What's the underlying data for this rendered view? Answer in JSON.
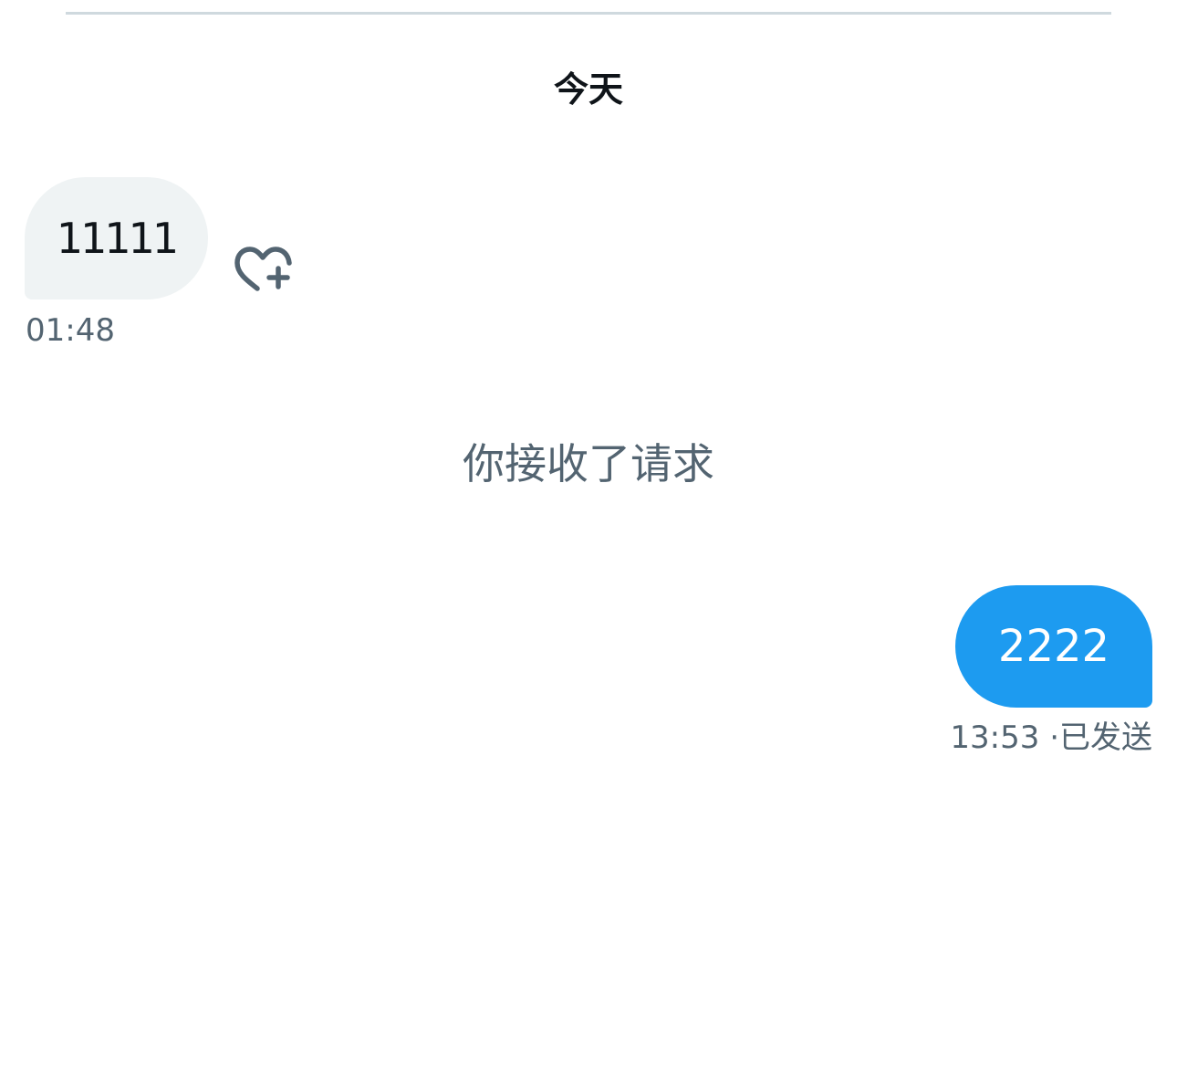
{
  "conversation": {
    "date_divider": "今天",
    "incoming": {
      "text": "11111",
      "time": "01:48",
      "reaction_icon": "heart-plus-icon"
    },
    "system_message": "你接收了请求",
    "outgoing": {
      "text": "2222",
      "time": "13:53",
      "separator": "·",
      "status": "已发送"
    }
  },
  "colors": {
    "accent": "#1d9bf0",
    "incoming_bubble": "#eff3f4",
    "secondary_text": "#536471",
    "primary_text": "#0f1419",
    "divider": "#cfd9de"
  }
}
